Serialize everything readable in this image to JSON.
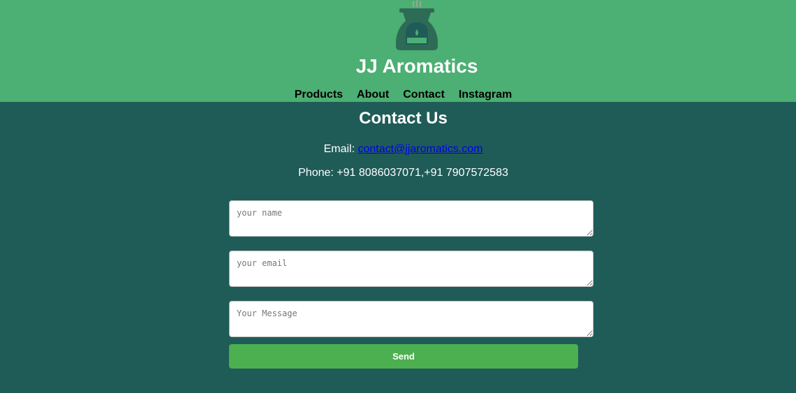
{
  "header": {
    "brand": "JJ Aromatics",
    "logo_icon": "oil-burner-icon",
    "colors": {
      "header_bg": "#4caf73",
      "page_bg": "#1f5c58"
    }
  },
  "nav": {
    "items": [
      "Products",
      "About",
      "Contact",
      "Instagram"
    ]
  },
  "contact": {
    "title": "Contact Us",
    "email_label": "Email: ",
    "email": "contact@jjaromatics.com",
    "phone_label": "Phone: ",
    "phone": "+91 8086037071,+91 7907572583"
  },
  "form": {
    "name_placeholder": "your name",
    "email_placeholder": "your email",
    "message_placeholder": "Your Message",
    "send_label": "Send",
    "send_color": "#4caf50"
  }
}
